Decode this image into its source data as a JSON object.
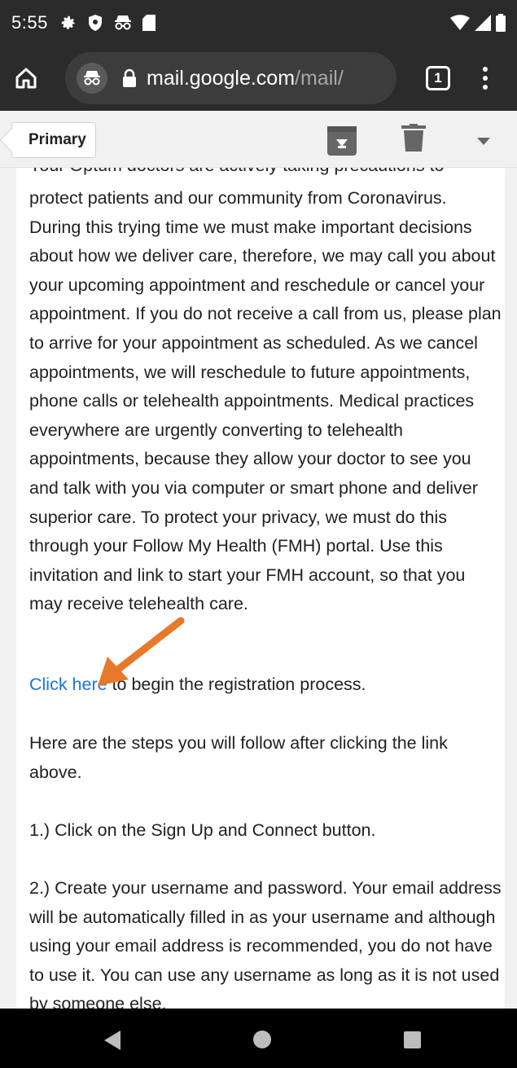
{
  "status_bar": {
    "time": "5:55",
    "left_icons": [
      "settings-gear-icon",
      "shield-icon",
      "incognito-icon",
      "sd-card-icon"
    ],
    "right_icons": [
      "wifi-icon",
      "signal-icon",
      "battery-icon"
    ]
  },
  "browser": {
    "url_host": "mail.google.com",
    "url_path": "/mail/",
    "tab_count": "1"
  },
  "gmail": {
    "label": "Primary",
    "actions": [
      "archive-icon",
      "delete-icon",
      "more-dropdown-icon"
    ]
  },
  "email": {
    "cut_line": "Your Optum doctors are actively taking precautions to",
    "paragraph_main": "protect patients and our community from Coronavirus. During this trying time we must make important decisions about how we deliver care, therefore, we may call you about your upcoming appointment and reschedule or cancel your appointment. If you do not receive a call from us, please plan to arrive for your appointment as scheduled. As we cancel appointments, we will reschedule to future appointments, phone calls or telehealth appointments. Medical practices everywhere are urgently converting to telehealth appointments, because they allow your doctor to see you and talk with you via computer or smart phone and deliver superior care. To protect your privacy, we must do this through your Follow My Health (FMH) portal. Use this invitation and link to start your FMH account, so that you may receive telehealth care.",
    "link_text": "Click here",
    "link_suffix": " to begin the registration process.",
    "steps_intro": "Here are the steps you will follow after clicking the link above.",
    "step_1": "1.) Click on the Sign Up and Connect button.",
    "step_2": "2.) Create your username and password. Your email address will be automatically filled in as your username and although using your email address is recommended, you do not have to use it. You can use any username as long as it is not used by someone else."
  },
  "annotation": {
    "arrow_color": "#e8782a"
  },
  "nav": {
    "buttons": [
      "back-icon",
      "home-icon",
      "recents-icon"
    ]
  }
}
